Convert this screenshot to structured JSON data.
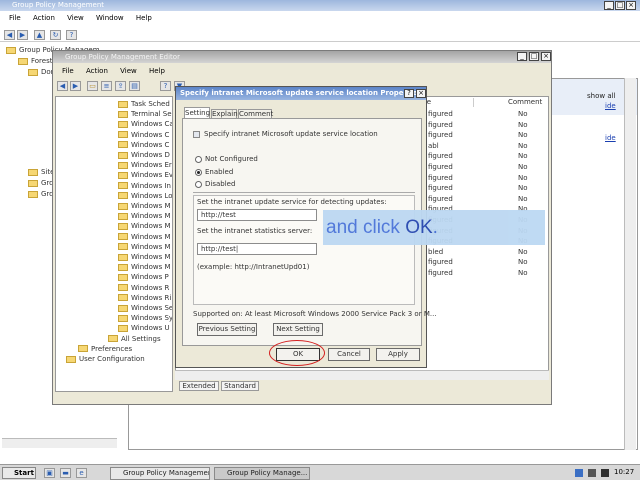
{
  "desktop_window": {
    "title": "Group Policy Management",
    "menu": [
      "File",
      "Action",
      "View",
      "Window",
      "Help"
    ],
    "tree": [
      "Group Policy Managem",
      "Forest",
      "Dom",
      "Site",
      "Grou",
      "Grou"
    ],
    "right_panel": {
      "show_all": "show all",
      "link1": "ide",
      "link2": "ide"
    }
  },
  "editor_window": {
    "title": "Group Policy Management Editor",
    "menu": [
      "File",
      "Action",
      "View",
      "Help"
    ],
    "tree_items": [
      "Task Sched",
      "Terminal Se",
      "Windows Ca",
      "Windows C",
      "Windows C",
      "Windows D",
      "Windows Er",
      "Windows Ev",
      "Windows In",
      "Windows Lo",
      "Windows M",
      "Windows M",
      "Windows M",
      "Windows M",
      "Windows M",
      "Windows M",
      "Windows M",
      "Windows P",
      "Windows R",
      "Windows Ri",
      "Windows Se",
      "Windows Sy",
      "Windows U",
      "All Settings",
      "Preferences",
      "User Configuration"
    ],
    "col_state_header": "te",
    "col_comment_header": "Comment",
    "state_values": [
      "figured",
      "figured",
      "figured",
      "abl",
      "figured",
      "figured",
      "figured",
      "figured",
      "figured",
      "figured",
      "figured",
      "figured",
      "figured",
      "bled",
      "figured",
      "figured"
    ],
    "comment_values": [
      "No",
      "No",
      "No",
      "No",
      "No",
      "No",
      "No",
      "No",
      "No",
      "No",
      "No",
      "No",
      "No",
      "No",
      "No",
      "No"
    ],
    "bottom_tabs": [
      "Extended",
      "Standard"
    ]
  },
  "dialog": {
    "title": "Specify intranet Microsoft update service location Properties",
    "tabs": [
      "Setting",
      "Explain",
      "Comment"
    ],
    "policy_name": "Specify intranet Microsoft update service location",
    "radio_not_configured": "Not Configured",
    "radio_enabled": "Enabled",
    "radio_disabled": "Disabled",
    "label_update_service": "Set the intranet update service for detecting updates:",
    "value_update_service": "http://test",
    "label_stats_server": "Set the intranet statistics server:",
    "value_stats_server": "http://test|",
    "example": "(example: http://IntranetUpd01)",
    "supported_on": "Supported on:   At least Microsoft Windows 2000 Service Pack 3 or M...",
    "previous_setting": "Previous Setting",
    "next_setting": "Next Setting",
    "ok": "OK",
    "cancel": "Cancel",
    "apply": "Apply"
  },
  "caption": {
    "prefix": "and click ",
    "emphasis": "OK",
    "suffix": "."
  },
  "taskbar": {
    "start": "Start",
    "task1": "Group Policy Management",
    "task2": "Group Policy Manage...",
    "clock": "10:27"
  },
  "colors": {
    "caption_bg": "#bcd8f2",
    "caption_text": "#4a73d9",
    "highlight_circle": "#d42020"
  }
}
